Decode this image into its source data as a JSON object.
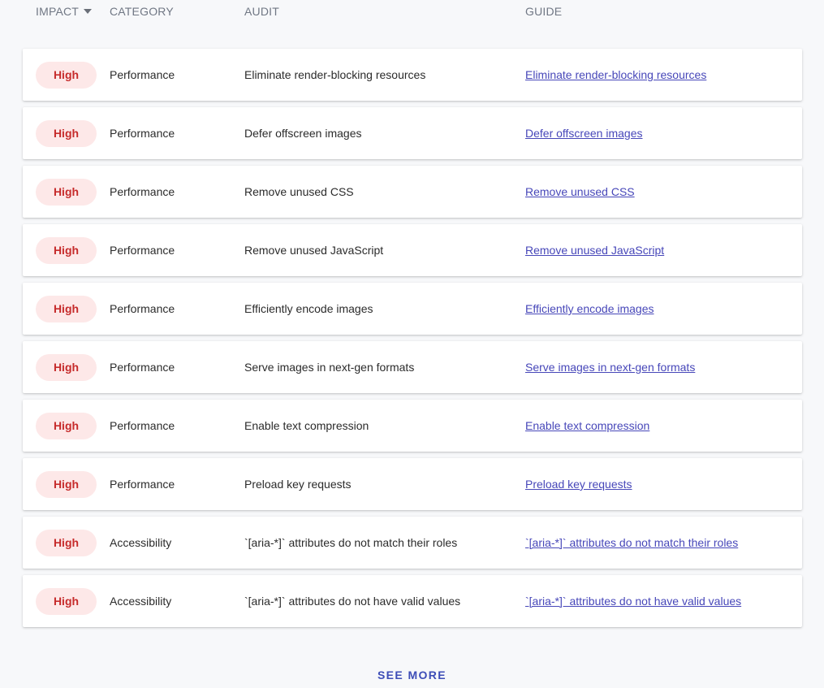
{
  "header": {
    "impact": "Impact",
    "category": "Category",
    "audit": "Audit",
    "guide": "Guide",
    "sort_icon": "caret-down-icon"
  },
  "rows": [
    {
      "impact": "High",
      "category": "Performance",
      "audit": "Eliminate render-blocking resources",
      "guide": "Eliminate render-blocking resources"
    },
    {
      "impact": "High",
      "category": "Performance",
      "audit": "Defer offscreen images",
      "guide": "Defer offscreen images"
    },
    {
      "impact": "High",
      "category": "Performance",
      "audit": "Remove unused CSS",
      "guide": "Remove unused CSS"
    },
    {
      "impact": "High",
      "category": "Performance",
      "audit": "Remove unused JavaScript",
      "guide": "Remove unused JavaScript"
    },
    {
      "impact": "High",
      "category": "Performance",
      "audit": "Efficiently encode images",
      "guide": "Efficiently encode images"
    },
    {
      "impact": "High",
      "category": "Performance",
      "audit": "Serve images in next-gen formats",
      "guide": "Serve images in next-gen formats"
    },
    {
      "impact": "High",
      "category": "Performance",
      "audit": "Enable text compression",
      "guide": "Enable text compression"
    },
    {
      "impact": "High",
      "category": "Performance",
      "audit": "Preload key requests",
      "guide": "Preload key requests"
    },
    {
      "impact": "High",
      "category": "Accessibility",
      "audit": "`[aria-*]` attributes do not match their roles",
      "guide": "`[aria-*]` attributes do not match their roles"
    },
    {
      "impact": "High",
      "category": "Accessibility",
      "audit": "`[aria-*]` attributes do not have valid values",
      "guide": "`[aria-*]` attributes do not have valid values"
    }
  ],
  "footer": {
    "see_more": "SEE MORE"
  },
  "colors": {
    "impact_high_bg": "#fde8e8",
    "impact_high_text": "#c62b2b",
    "link": "#4747b9",
    "see_more": "#3d4db7"
  }
}
